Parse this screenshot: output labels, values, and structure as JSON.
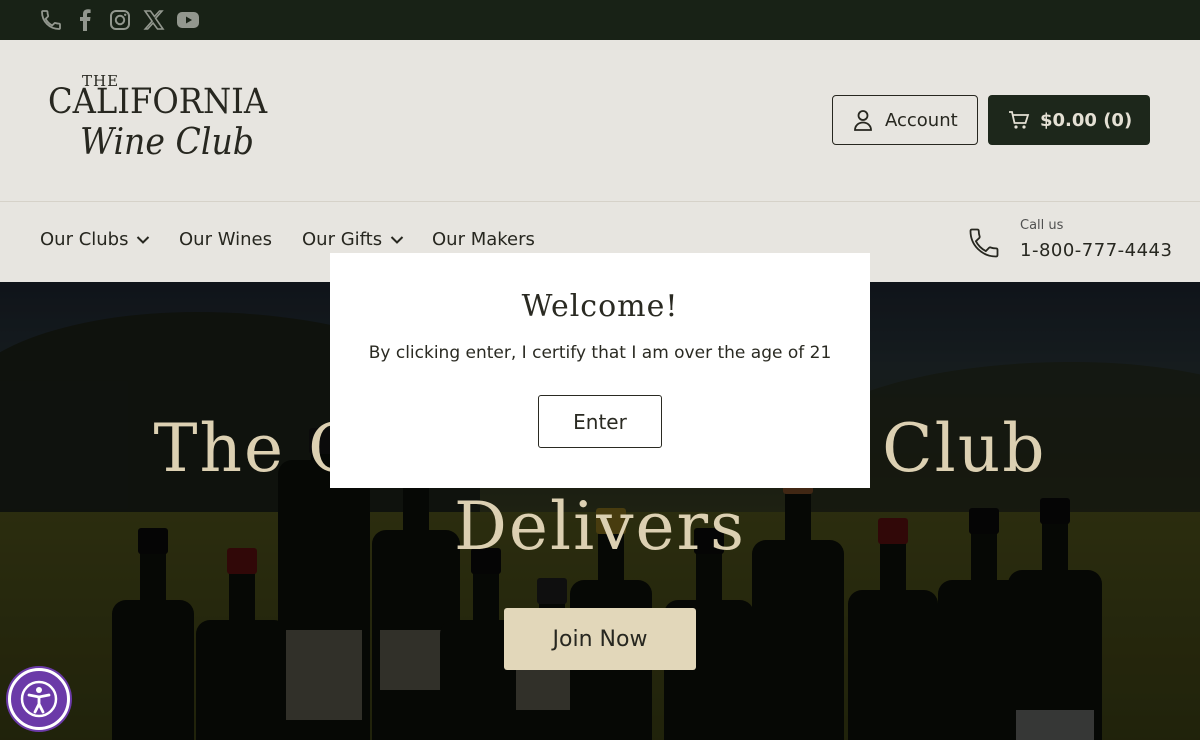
{
  "topbar": {
    "icons": [
      "phone-icon",
      "facebook-icon",
      "instagram-icon",
      "x-icon",
      "youtube-icon"
    ]
  },
  "header": {
    "logo": {
      "line1": "THE",
      "line2": "CALIFORNIA",
      "line3": "Wine Club"
    },
    "account_label": "Account",
    "cart_label": "$0.00 (0)"
  },
  "nav": {
    "items": [
      {
        "label": "Our Clubs",
        "has_dropdown": true
      },
      {
        "label": "Our Wines",
        "has_dropdown": false
      },
      {
        "label": "Our Gifts",
        "has_dropdown": true
      },
      {
        "label": "Our Makers",
        "has_dropdown": false
      }
    ],
    "call_label": "Call us",
    "phone": "1-800-777-4443"
  },
  "hero": {
    "title_line1": "The California Wine Club",
    "title_line2": "Delivers",
    "cta": "Join Now"
  },
  "modal": {
    "title": "Welcome!",
    "message": "By clicking enter, I certify that I am over the age of 21",
    "button": "Enter"
  },
  "colors": {
    "topbar": "#1a2418",
    "cart_button": "#1f2a1d",
    "accessibility": "#6b3aa8",
    "hero_text": "#e8dcbc"
  }
}
